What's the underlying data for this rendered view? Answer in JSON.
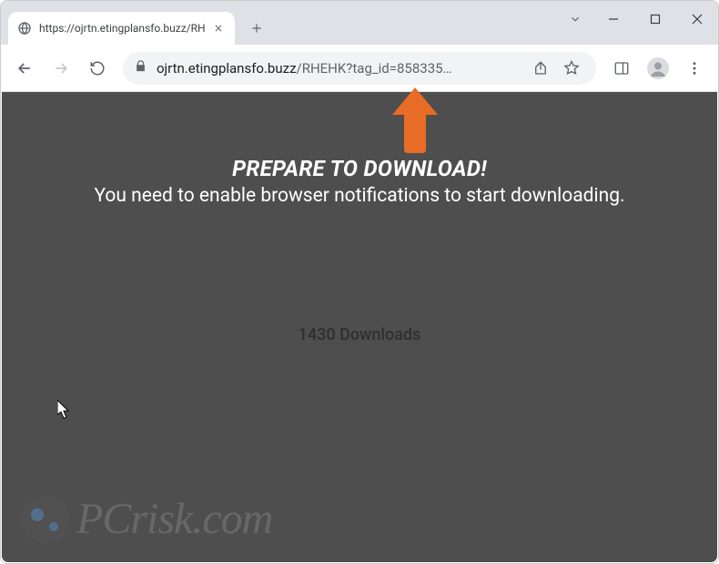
{
  "window": {
    "tab_title": "https://ojrtn.etingplansfo.buzz/RH"
  },
  "addressbar": {
    "domain": "ojrtn.etingplansfo.buzz",
    "path": "/RHEHK?tag_id=858335…"
  },
  "page": {
    "headline": "PREPARE TO DOWNLOAD!",
    "subhead": "You need to enable browser notifications to start downloading.",
    "downloads_text": "1430 Downloads"
  },
  "watermark": {
    "text": "PCrisk.com"
  },
  "colors": {
    "page_bg": "#4e4e4e",
    "arrow": "#e86c25"
  }
}
